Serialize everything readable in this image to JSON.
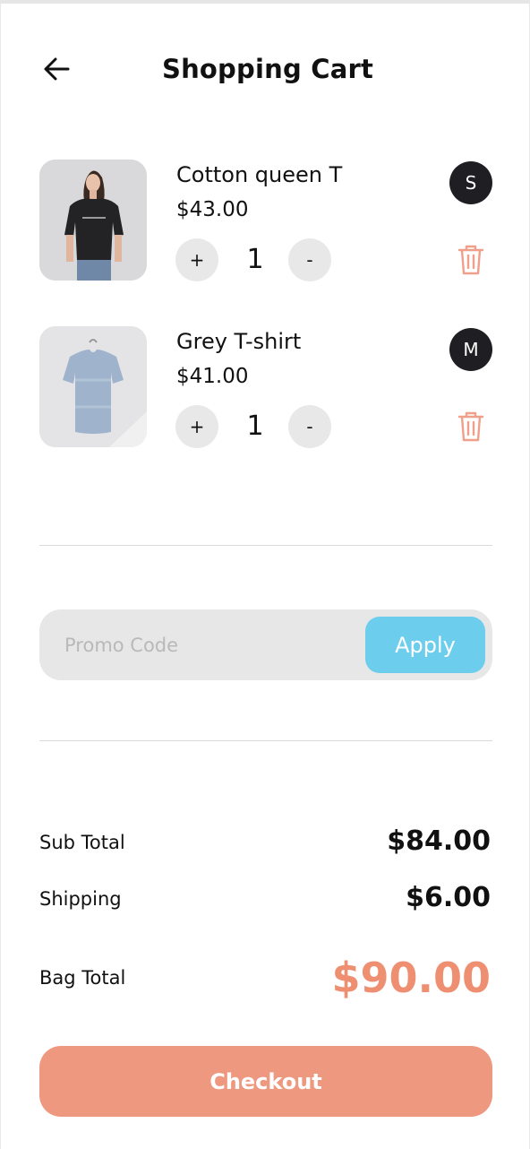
{
  "header": {
    "title": "Shopping Cart",
    "back_icon": "arrow-left-icon"
  },
  "cart": {
    "items": [
      {
        "name": "Cotton queen T",
        "price": "$43.00",
        "quantity": "1",
        "size": "S",
        "plus_label": "+",
        "minus_label": "-",
        "image": "woman-black-tshirt-photo",
        "delete_icon": "trash-icon"
      },
      {
        "name": "Grey T-shirt",
        "price": "$41.00",
        "quantity": "1",
        "size": "M",
        "plus_label": "+",
        "minus_label": "-",
        "image": "grey-tshirt-hanger-photo",
        "delete_icon": "trash-icon"
      }
    ]
  },
  "promo": {
    "placeholder": "Promo Code",
    "value": "",
    "apply_label": "Apply"
  },
  "summary": {
    "subtotal_label": "Sub Total",
    "subtotal_value": "$84.00",
    "shipping_label": "Shipping",
    "shipping_value": "$6.00",
    "bag_total_label": "Bag Total",
    "bag_total_value": "$90.00"
  },
  "checkout": {
    "label": "Checkout"
  },
  "colors": {
    "accent": "#ee8f72",
    "apply": "#6dcdec",
    "badge": "#1f1f23",
    "trash": "#f0a08a"
  }
}
